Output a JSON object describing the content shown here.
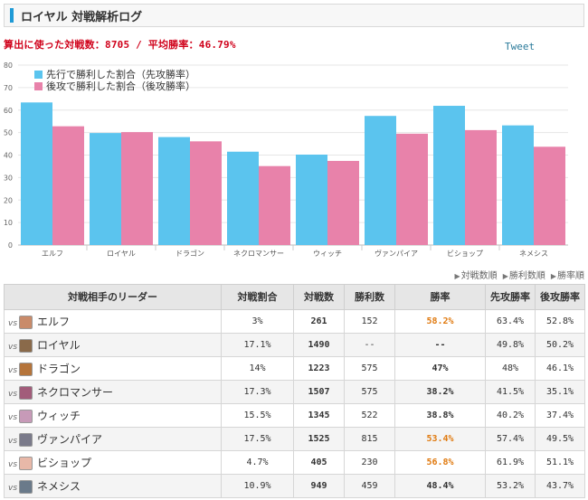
{
  "header": {
    "title": "ロイヤル 対戦解析ログ"
  },
  "summary": {
    "text": "算出に使った対戦数：8705 / 平均勝率：46.79%"
  },
  "tweet": {
    "label": "Tweet"
  },
  "chart_data": {
    "type": "bar",
    "categories": [
      "エルフ",
      "ロイヤル",
      "ドラゴン",
      "ネクロマンサー",
      "ウィッチ",
      "ヴァンパイア",
      "ビショップ",
      "ネメシス"
    ],
    "series": [
      {
        "name": "先行で勝利した割合（先攻勝率）",
        "color": "#5bc4ee",
        "values": [
          63.4,
          49.8,
          48,
          41.5,
          40.2,
          57.4,
          61.9,
          53.2
        ]
      },
      {
        "name": "後攻で勝利した割合（後攻勝率）",
        "color": "#e882aa",
        "values": [
          52.8,
          50.2,
          46.1,
          35.1,
          37.4,
          49.5,
          51.1,
          43.7
        ]
      }
    ],
    "yticks": [
      0,
      10,
      20,
      30,
      40,
      50,
      60,
      70,
      80
    ],
    "ylim": [
      0,
      80
    ],
    "grid": true,
    "legend": "top-left"
  },
  "sort": {
    "items": [
      "対戦数順",
      "勝利数順",
      "勝率順"
    ]
  },
  "table": {
    "headers": [
      "対戦相手のリーダー",
      "対戦割合",
      "対戦数",
      "勝利数",
      "勝率",
      "先攻勝率",
      "後攻勝率"
    ],
    "vs_label": "vs",
    "rows": [
      {
        "leader": "エルフ",
        "ratio": "3%",
        "games": "261",
        "wins": "152",
        "rate": "58.2%",
        "first": "63.4%",
        "second": "52.8%",
        "avatar": "#c98b6a",
        "hi": true
      },
      {
        "leader": "ロイヤル",
        "ratio": "17.1%",
        "games": "1490",
        "wins": "--",
        "rate": "--",
        "first": "49.8%",
        "second": "50.2%",
        "avatar": "#8a6a4a",
        "hi": false
      },
      {
        "leader": "ドラゴン",
        "ratio": "14%",
        "games": "1223",
        "wins": "575",
        "rate": "47%",
        "first": "48%",
        "second": "46.1%",
        "avatar": "#b5743a",
        "hi": false
      },
      {
        "leader": "ネクロマンサー",
        "ratio": "17.3%",
        "games": "1507",
        "wins": "575",
        "rate": "38.2%",
        "first": "41.5%",
        "second": "35.1%",
        "avatar": "#a25c7a",
        "hi": false
      },
      {
        "leader": "ウィッチ",
        "ratio": "15.5%",
        "games": "1345",
        "wins": "522",
        "rate": "38.8%",
        "first": "40.2%",
        "second": "37.4%",
        "avatar": "#c79ab8",
        "hi": false
      },
      {
        "leader": "ヴァンパイア",
        "ratio": "17.5%",
        "games": "1525",
        "wins": "815",
        "rate": "53.4%",
        "first": "57.4%",
        "second": "49.5%",
        "avatar": "#7a7a8a",
        "hi": true
      },
      {
        "leader": "ビショップ",
        "ratio": "4.7%",
        "games": "405",
        "wins": "230",
        "rate": "56.8%",
        "first": "61.9%",
        "second": "51.1%",
        "avatar": "#e8b8a8",
        "hi": true
      },
      {
        "leader": "ネメシス",
        "ratio": "10.9%",
        "games": "949",
        "wins": "459",
        "rate": "48.4%",
        "first": "53.2%",
        "second": "43.7%",
        "avatar": "#6a7a8a",
        "hi": false
      }
    ]
  }
}
